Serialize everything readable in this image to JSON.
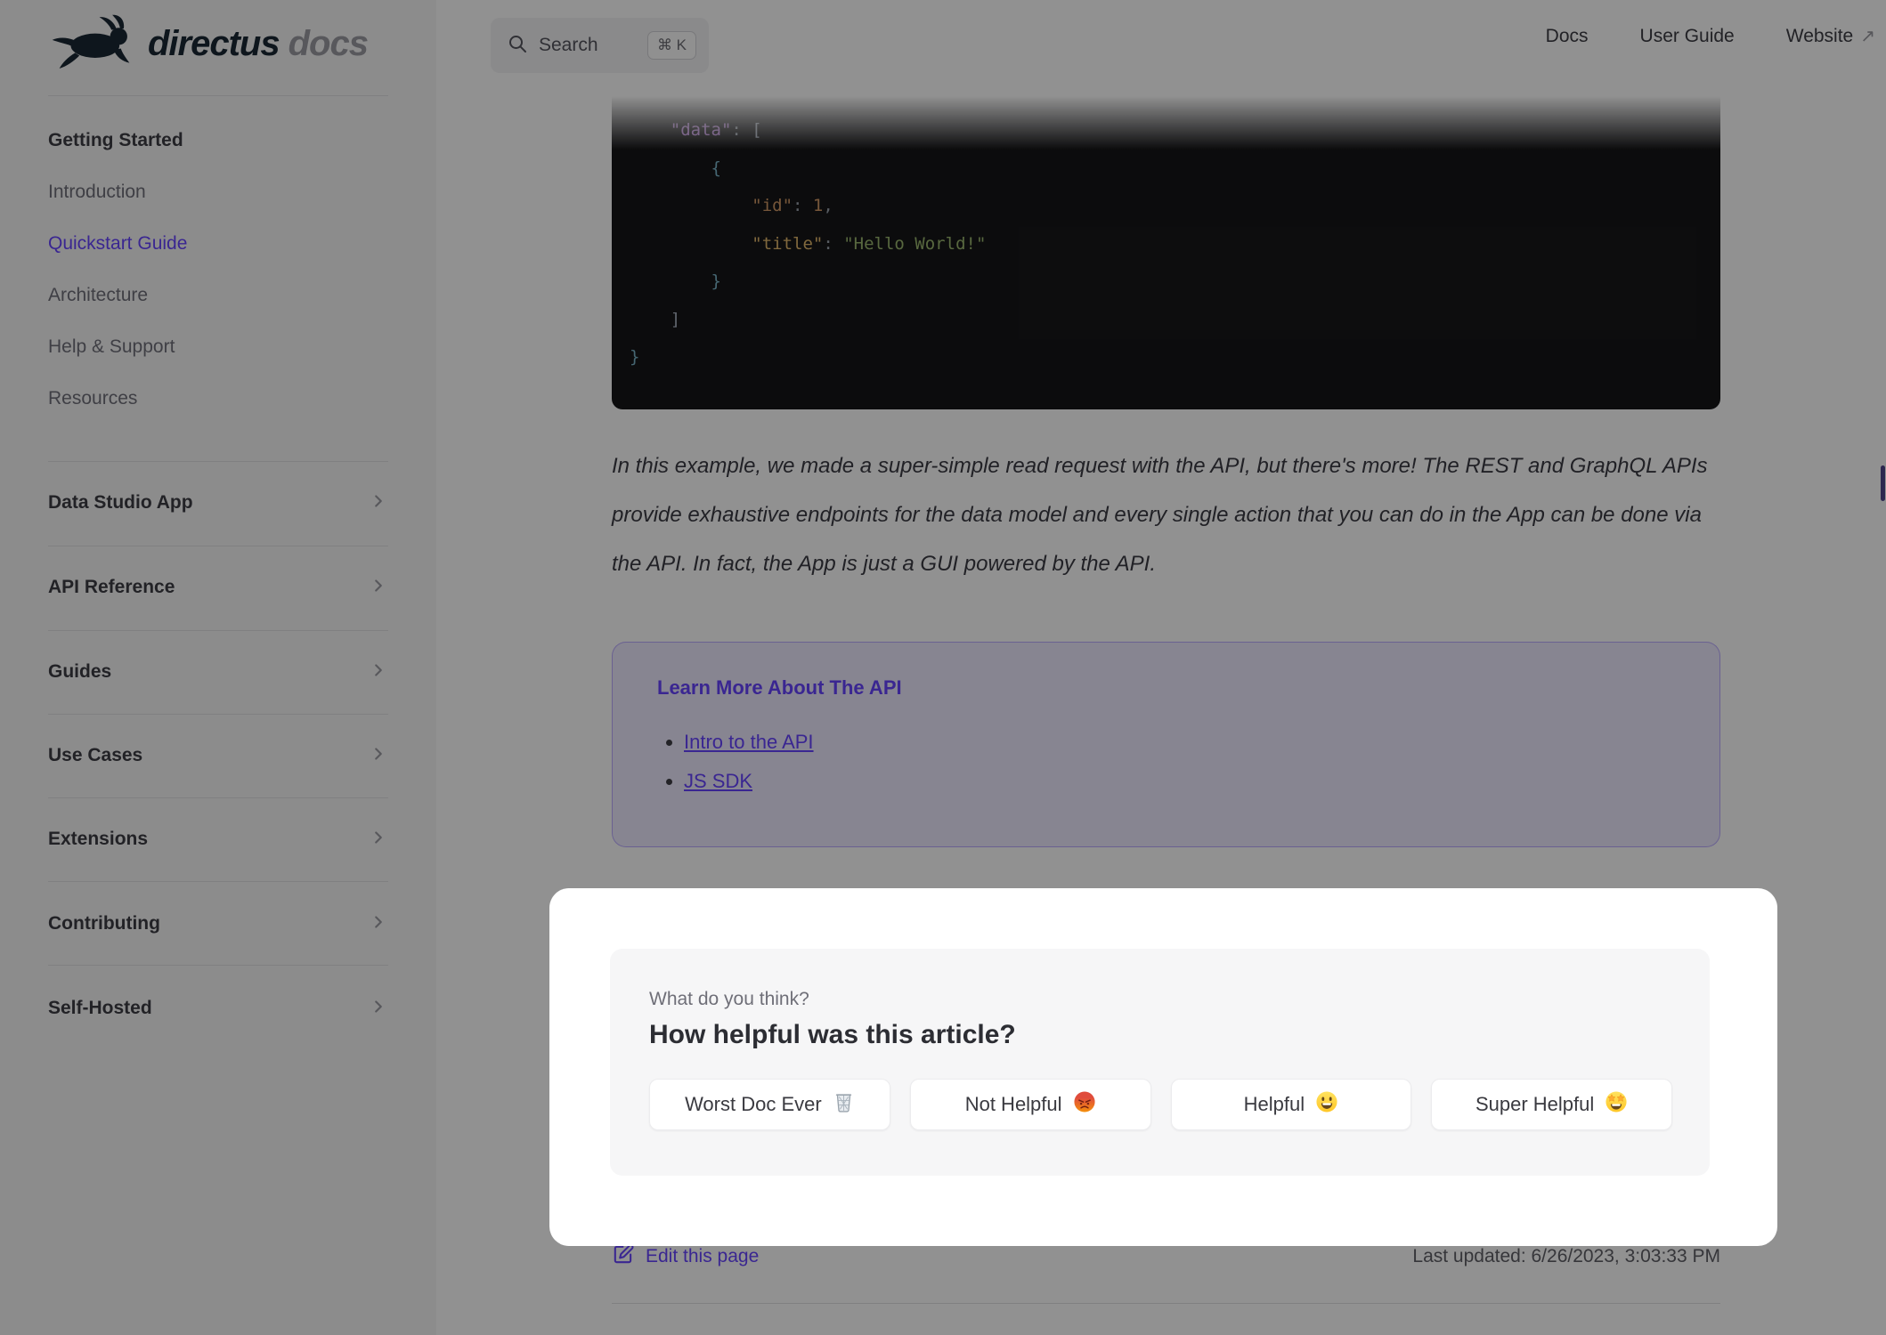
{
  "brand": {
    "name": "directus",
    "suffix": "docs"
  },
  "header": {
    "search": {
      "label": "Search",
      "shortcut": "⌘ K"
    },
    "nav": [
      {
        "label": "Docs"
      },
      {
        "label": "User Guide"
      },
      {
        "label": "Website",
        "arrow": "↗"
      }
    ]
  },
  "sidebar": {
    "group_title": "Getting Started",
    "items": [
      {
        "label": "Introduction"
      },
      {
        "label": "Quickstart Guide"
      },
      {
        "label": "Architecture"
      },
      {
        "label": "Help & Support"
      },
      {
        "label": "Resources"
      }
    ],
    "sections": [
      {
        "label": "Data Studio App"
      },
      {
        "label": "API Reference"
      },
      {
        "label": "Guides"
      },
      {
        "label": "Use Cases"
      },
      {
        "label": "Extensions"
      },
      {
        "label": "Contributing"
      },
      {
        "label": "Self-Hosted"
      }
    ]
  },
  "content": {
    "code": {
      "lines": [
        [
          {
            "t": "    \"data\"",
            "c": "key"
          },
          {
            "t": ": ",
            "c": "punct"
          },
          {
            "t": "[",
            "c": "bracket"
          }
        ],
        [
          {
            "t": "        {",
            "c": "brace"
          }
        ],
        [
          {
            "t": "            \"id\"",
            "c": "prop"
          },
          {
            "t": ": ",
            "c": "punct"
          },
          {
            "t": "1",
            "c": "number"
          },
          {
            "t": ",",
            "c": "punct"
          }
        ],
        [
          {
            "t": "            \"title\"",
            "c": "prop2"
          },
          {
            "t": ": ",
            "c": "punct"
          },
          {
            "t": "\"Hello World!\"",
            "c": "string"
          }
        ],
        [
          {
            "t": "        }",
            "c": "brace"
          }
        ],
        [
          {
            "t": "    ]",
            "c": "bracket"
          }
        ],
        [
          {
            "t": "}",
            "c": "brace"
          }
        ]
      ]
    },
    "paragraph": "In this example, we made a super-simple read request with the API, but there's more! The REST and GraphQL APIs provide exhaustive endpoints for the data model and every single action that you can do in the App can be done via the API. In fact, the App is just a GUI powered by the API.",
    "callout": {
      "title": "Learn More About The API",
      "links": [
        {
          "label": "Intro to the API"
        },
        {
          "label": "JS SDK"
        }
      ]
    },
    "footer": {
      "edit_label": "Edit this page",
      "last_updated": "Last updated: 6/26/2023, 3:03:33 PM"
    }
  },
  "feedback": {
    "kicker": "What do you think?",
    "title": "How helpful was this article?",
    "buttons": [
      {
        "label": "Worst Doc Ever",
        "emoji": "🗑️"
      },
      {
        "label": "Not Helpful",
        "emoji": "😡"
      },
      {
        "label": "Helpful",
        "emoji": "😃"
      },
      {
        "label": "Super Helpful",
        "emoji": "🤩"
      }
    ]
  },
  "colors": {
    "accent": "#6644ff",
    "code_bg": "#161618",
    "sidebar_bg": "#f6f6f7",
    "overlay": "rgba(0,0,0,0.43)"
  }
}
